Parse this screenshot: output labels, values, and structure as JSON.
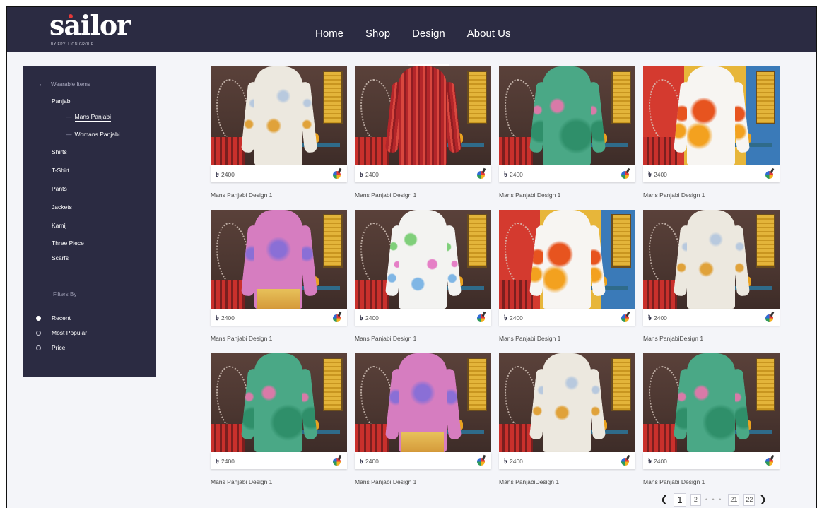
{
  "brand": {
    "name": "sailor",
    "tagline": "BY EPYLLION GROUP",
    "accent": "#e53939"
  },
  "nav": {
    "items": [
      {
        "label": "Home"
      },
      {
        "label": "Shop"
      },
      {
        "label": "Design"
      },
      {
        "label": "About Us"
      }
    ],
    "active": "Design"
  },
  "sidebar": {
    "back_label": "Wearable Items",
    "categories": [
      "Panjabi",
      "Shirts",
      "T-Shirt",
      "Pants",
      "Jackets",
      "Kamij",
      "Three Piece",
      "Scarfs"
    ],
    "subcategories": [
      "Mans Panjabi",
      "Womans Panjabi"
    ],
    "active_subcategory": "Mans Panjabi",
    "filters_title": "Filters By",
    "filters": [
      {
        "label": "Recent",
        "checked": true
      },
      {
        "label": "Most Popular",
        "checked": false
      },
      {
        "label": "Price",
        "checked": false
      }
    ]
  },
  "products": [
    {
      "currency": "৳",
      "price": "2400",
      "name": "Mans Panjabi Design 1",
      "style": "white"
    },
    {
      "currency": "৳",
      "price": "2400",
      "name": "Mans  Panjabi Design 1",
      "style": "red"
    },
    {
      "currency": "৳",
      "price": "2400",
      "name": "Mans Panjabi Design 1",
      "style": "green"
    },
    {
      "currency": "৳",
      "price": "2400",
      "name": "Mans Panjabi Design 1",
      "style": "floral"
    },
    {
      "currency": "৳",
      "price": "2400",
      "name": "Mans Panjabi Design 1",
      "style": "pink"
    },
    {
      "currency": "৳",
      "price": "2400",
      "name": "Mans Panjabi Design 1",
      "style": "dots"
    },
    {
      "currency": "৳",
      "price": "2400",
      "name": "Mans Panjabi Design 1",
      "style": "floral"
    },
    {
      "currency": "৳",
      "price": "2400",
      "name": "Mans PanjabiDesign 1",
      "style": "white"
    },
    {
      "currency": "৳",
      "price": "2400",
      "name": "Mans Panjabi Design 1",
      "style": "green"
    },
    {
      "currency": "৳",
      "price": "2400",
      "name": "Mans Panjabi Design 1",
      "style": "pink"
    },
    {
      "currency": "৳",
      "price": "2400",
      "name": "Mans PanjabiDesign 1",
      "style": "white"
    },
    {
      "currency": "৳",
      "price": "2400",
      "name": "Mans Panjabi Design 1",
      "style": "green"
    }
  ],
  "pagination": {
    "prev_icon": "chevron-left-icon",
    "next_icon": "chevron-right-icon",
    "pages": [
      "1",
      "2",
      "21",
      "22"
    ],
    "current": "1",
    "ellipsis": "• • •"
  },
  "colors": {
    "header_bg": "#2b2b42",
    "sidebar_bg": "#2b2b42",
    "page_bg": "#f4f5f9"
  }
}
